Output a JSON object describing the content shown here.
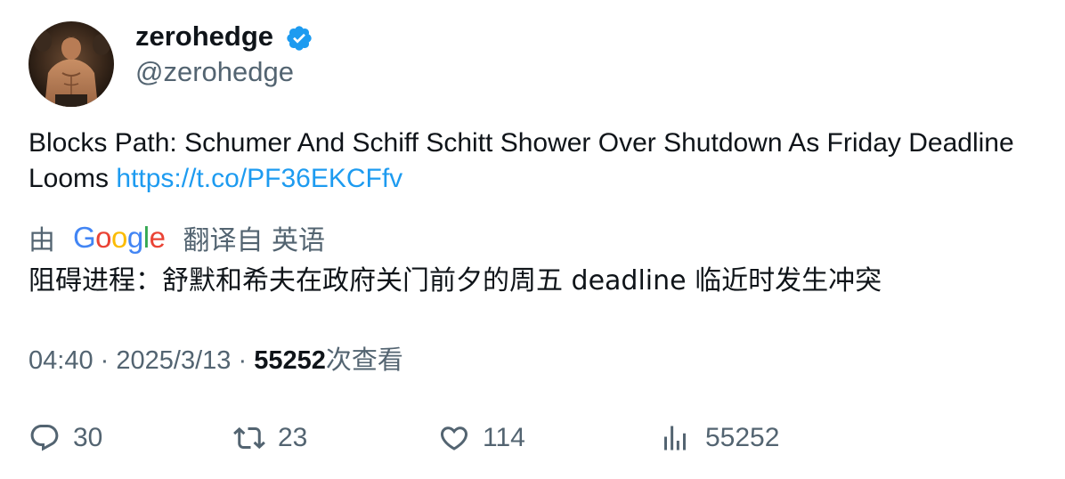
{
  "tweet": {
    "author": {
      "display_name": "zerohedge",
      "handle": "@zerohedge",
      "verified": true
    },
    "text": "Blocks Path: Schumer And Schiff Schitt Shower Over Shutdown As Friday Deadline Looms ",
    "link": "https://t.co/PF36EKCFfv",
    "translation": {
      "by_label": "由",
      "provider": "Google",
      "from_label": "翻译自 英语",
      "text": "阻碍进程：舒默和希夫在政府关门前夕的周五 deadline 临近时发生冲突"
    },
    "meta": {
      "time": "04:40",
      "separator": "·",
      "date": "2025/3/13",
      "views_count": "55252",
      "views_label": "次查看"
    },
    "actions": {
      "replies": "30",
      "retweets": "23",
      "likes": "114",
      "views": "55252"
    }
  },
  "colors": {
    "text": "#0f1419",
    "secondary": "#536471",
    "link": "#1d9bf0",
    "verified": "#1d9bf0"
  },
  "icons": [
    "verified-badge-icon",
    "reply-icon",
    "retweet-icon",
    "like-icon",
    "views-icon"
  ]
}
